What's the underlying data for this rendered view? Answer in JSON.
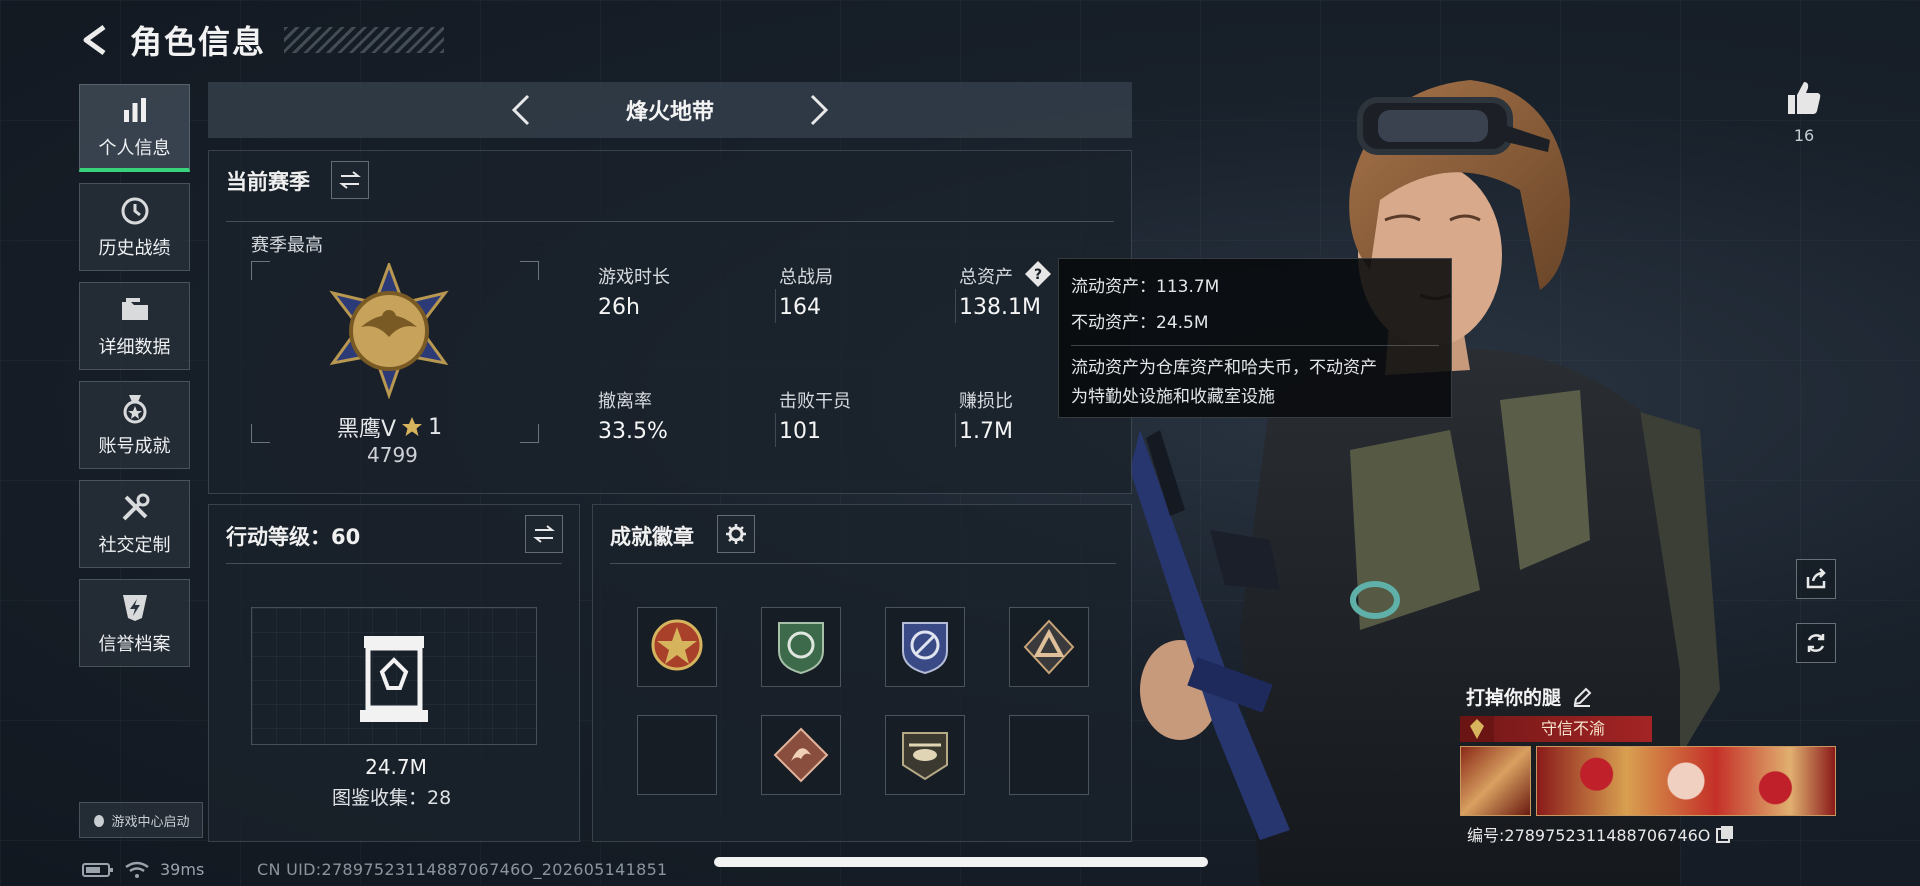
{
  "header": {
    "title": "角色信息"
  },
  "sidebar": {
    "items": [
      {
        "label": "个人信息",
        "icon": "bar-chart-icon",
        "active": true
      },
      {
        "label": "历史战绩",
        "icon": "history-icon"
      },
      {
        "label": "详细数据",
        "icon": "folder-icon"
      },
      {
        "label": "账号成就",
        "icon": "medal-icon"
      },
      {
        "label": "社交定制",
        "icon": "tools-icon"
      },
      {
        "label": "信誉档案",
        "icon": "shield-bolt-icon"
      }
    ],
    "launch_label": "游戏中心启动"
  },
  "mode": {
    "title": "烽火地带"
  },
  "season": {
    "title": "当前赛季",
    "best_label": "赛季最高",
    "rank_name": "黑鹰V",
    "rank_stars": "1",
    "rank_score": "4799",
    "stats": [
      {
        "label": "游戏时长",
        "value": "26h"
      },
      {
        "label": "总战局",
        "value": "164"
      },
      {
        "label": "总资产",
        "value": "138.1M"
      },
      {
        "label": "撤离率",
        "value": "33.5%"
      },
      {
        "label": "击败干员",
        "value": "101"
      },
      {
        "label": "赚损比",
        "value": "1.7M"
      }
    ]
  },
  "tooltip": {
    "liquid": "流动资产：113.7M",
    "fixed": "不动资产：24.5M",
    "desc_line1": "流动资产为仓库资产和哈夫币，不动资产",
    "desc_line2": "为特勤处设施和收藏室设施"
  },
  "action": {
    "title": "行动等级：60",
    "value": "24.7M",
    "collection": "图鉴收集：28"
  },
  "badges": {
    "title": "成就徽章",
    "slots": [
      "star-medal",
      "green-shield",
      "blue-eagle",
      "triangle-emblem",
      "empty",
      "dragon-diamond",
      "helicopter-badge",
      "empty"
    ]
  },
  "right": {
    "like_count": "16",
    "player_name": "打掉你的腿",
    "credit_label": "守信不渝",
    "serial": "编号:2789752311488706746O"
  },
  "status": {
    "ping": "39ms",
    "uid": "CN UID:2789752311488706746O_202605141851"
  }
}
